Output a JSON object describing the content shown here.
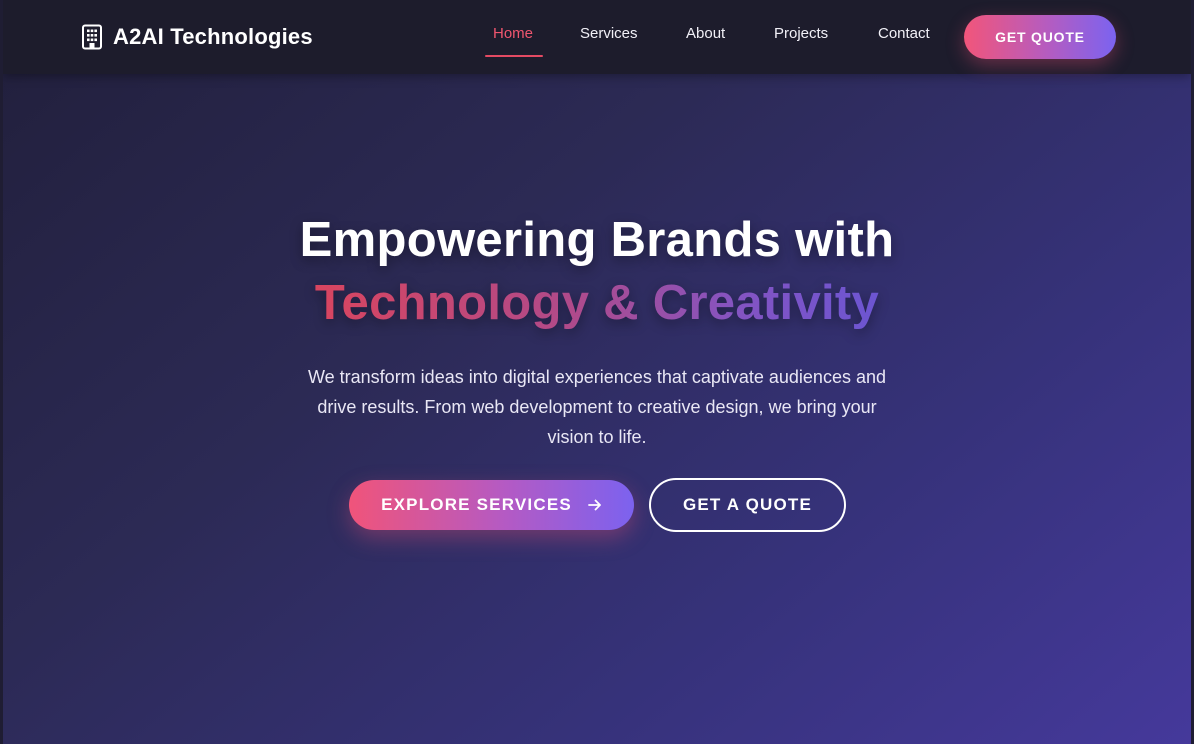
{
  "header": {
    "brand": "A2AI Technologies",
    "logo_icon": "building-icon",
    "nav": [
      {
        "label": "Home",
        "active": true
      },
      {
        "label": "Services",
        "active": false
      },
      {
        "label": "About",
        "active": false
      },
      {
        "label": "Projects",
        "active": false
      },
      {
        "label": "Contact",
        "active": false
      }
    ],
    "cta_label": "GET QUOTE"
  },
  "hero": {
    "title_line1": "Empowering Brands with",
    "title_line2": "Technology & Creativity",
    "description": "We transform ideas into digital experiences that captivate audiences and drive results. From web development to creative design, we bring your vision to life.",
    "primary_button": "EXPLORE SERVICES",
    "primary_button_icon": "arrow-right-icon",
    "secondary_button": "GET A QUOTE"
  },
  "colors": {
    "accent_pink": "#f0547a",
    "accent_purple": "#7c62ef",
    "nav_active": "#f0566f",
    "header_bg": "#1d1c2c"
  }
}
